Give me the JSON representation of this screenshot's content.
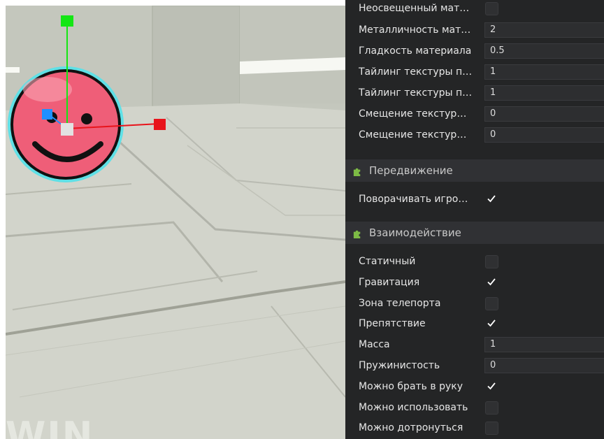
{
  "viewport": {
    "watermark": "WIN"
  },
  "inspector": {
    "material_rows": [
      {
        "label": "Неосвещенный мат…",
        "type": "checkbox",
        "checked": false
      },
      {
        "label": "Металличность мат…",
        "type": "number",
        "value": "2"
      },
      {
        "label": "Гладкость материала",
        "type": "number",
        "value": "0.5"
      },
      {
        "label": "Тайлинг текстуры п…",
        "type": "number",
        "value": "1"
      },
      {
        "label": "Тайлинг текстуры п…",
        "type": "number",
        "value": "1"
      },
      {
        "label": "Смещение текстур…",
        "type": "number",
        "value": "0"
      },
      {
        "label": "Смещение текстур…",
        "type": "number",
        "value": "0"
      }
    ],
    "movement_section": {
      "title": "Передвижение",
      "rows": [
        {
          "label": "Поворачивать игро…",
          "type": "checkmark",
          "checked": true
        }
      ]
    },
    "interaction_section": {
      "title": "Взаимодействие",
      "rows": [
        {
          "label": "Статичный",
          "type": "checkbox",
          "checked": false
        },
        {
          "label": "Гравитация",
          "type": "checkmark",
          "checked": true
        },
        {
          "label": "Зона телепорта",
          "type": "checkbox",
          "checked": false
        },
        {
          "label": "Препятствие",
          "type": "checkmark",
          "checked": true
        },
        {
          "label": "Масса",
          "type": "number",
          "value": "1"
        },
        {
          "label": "Пружинистость",
          "type": "number",
          "value": "0"
        },
        {
          "label": "Можно брать в руку",
          "type": "checkmark",
          "checked": true
        },
        {
          "label": "Можно использовать",
          "type": "checkbox",
          "checked": false
        },
        {
          "label": "Можно дотронуться",
          "type": "checkbox",
          "checked": false
        }
      ]
    }
  },
  "colors": {
    "panel_bg": "#242526",
    "section_header_bg": "#303134",
    "accent_green": "#7dbb45",
    "gizmo_x": "#e8141b",
    "gizmo_y": "#14e614",
    "gizmo_z": "#1e90ff",
    "smiley_face": "#f0607a",
    "selection_outline": "#5fe0e6"
  },
  "icons": {
    "section_icon": "puzzle-piece-icon",
    "check_icon": "checkmark-icon"
  }
}
